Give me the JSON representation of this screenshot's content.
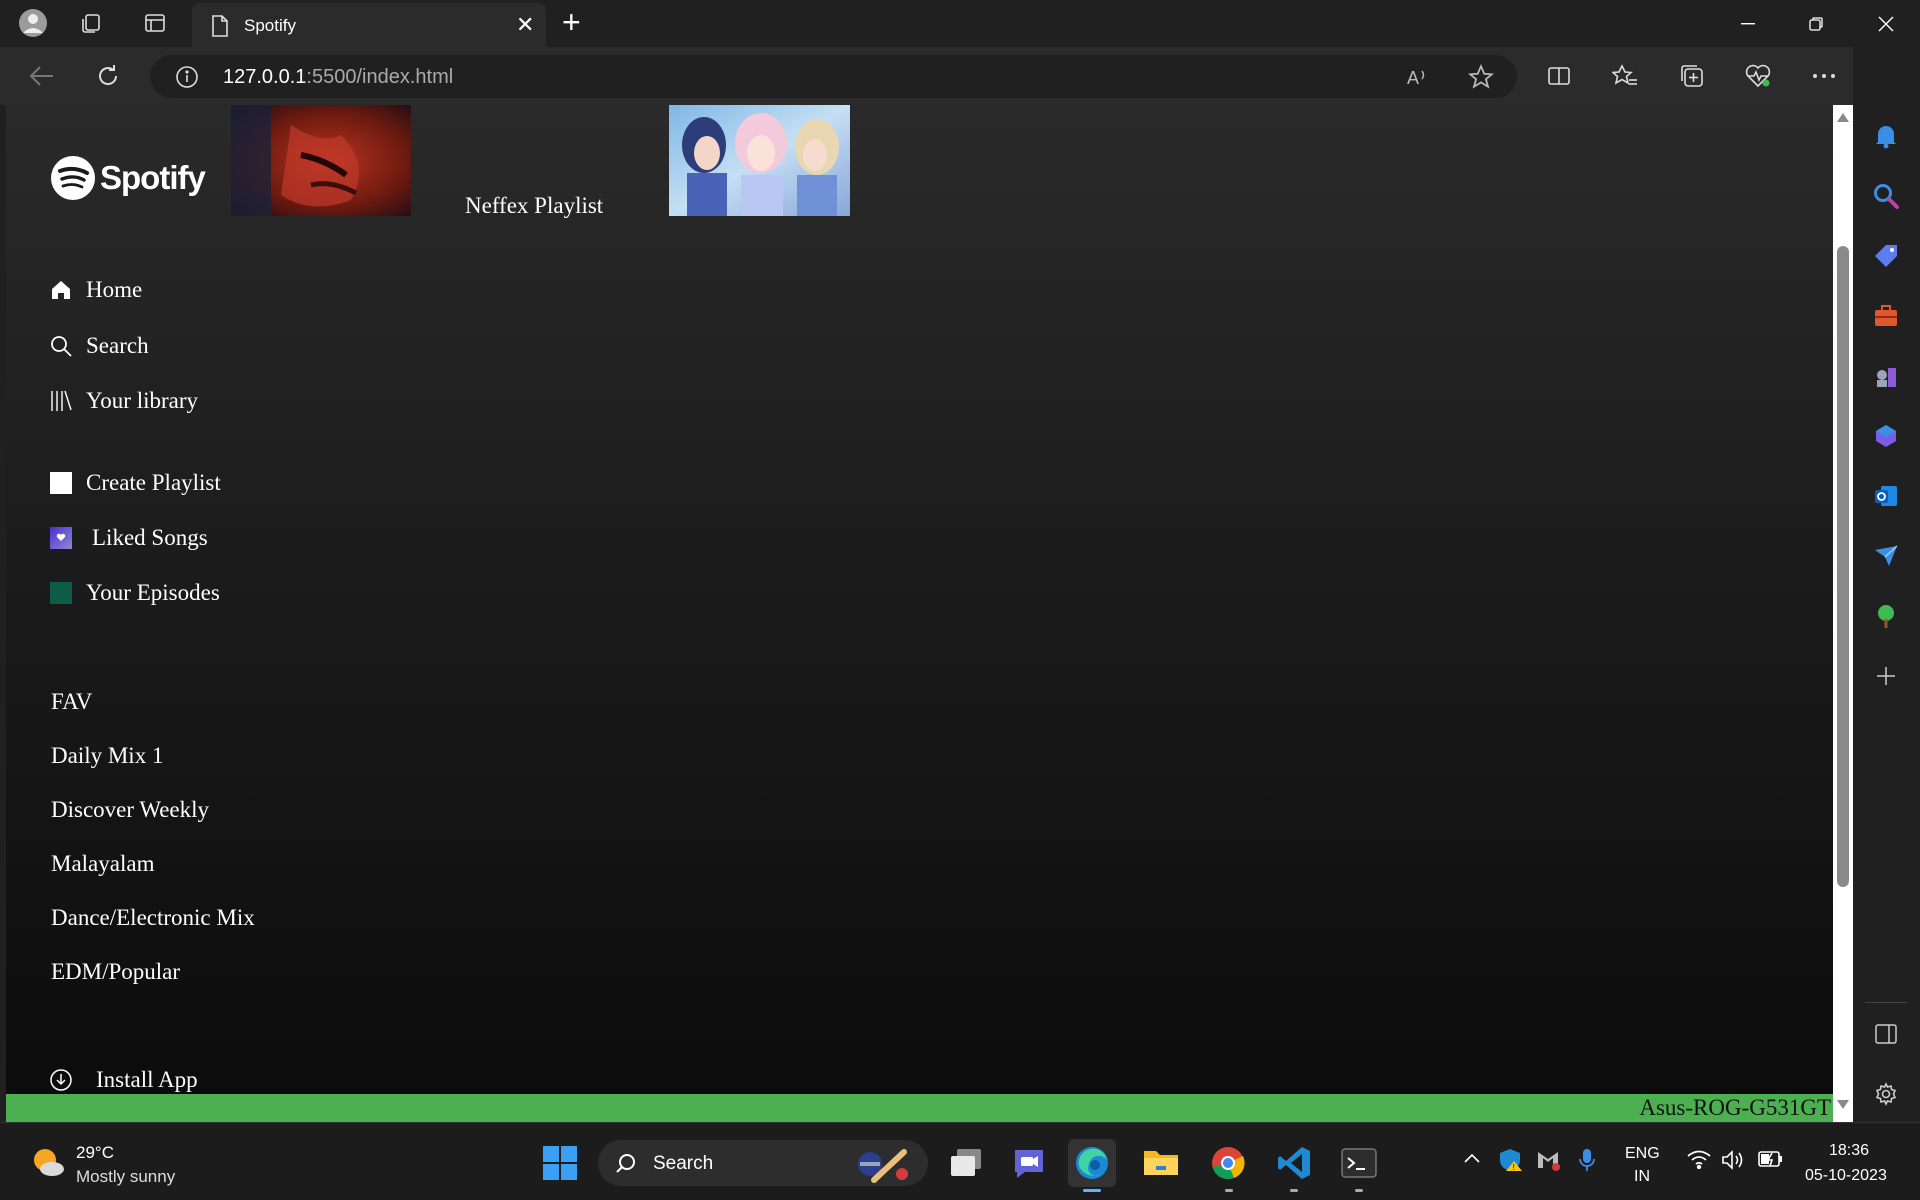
{
  "browser": {
    "tab_title": "Spotify",
    "tab_close": "✕",
    "new_tab": "+",
    "url_host": "127.0.0.1",
    "url_rest": ":5500/index.html",
    "window_controls": [
      "minimize-icon",
      "restore-icon",
      "close-icon"
    ]
  },
  "page": {
    "logo_text": "Spotify",
    "featured_title": "Neffex Playlist",
    "nav": [
      {
        "label": "Home",
        "icon": "home-icon"
      },
      {
        "label": "Search",
        "icon": "search-icon"
      },
      {
        "label": "Your library",
        "icon": "library-icon"
      }
    ],
    "actions": [
      {
        "label": "Create Playlist",
        "icon": "plus-square-icon"
      },
      {
        "label": "Liked Songs",
        "icon": "heart-icon"
      },
      {
        "label": "Your Episodes",
        "icon": "episodes-icon"
      }
    ],
    "playlists": [
      "FAV",
      "Daily Mix 1",
      "Discover Weekly",
      "Malayalam",
      "Dance/Electronic Mix",
      "EDM/Popular"
    ],
    "install_app": "Install App",
    "footer_text": "Asus-ROG-G531GT"
  },
  "taskbar": {
    "temperature": "29°C",
    "weather": "Mostly sunny",
    "search_label": "Search",
    "language_top": "ENG",
    "language_bottom": "IN",
    "time": "18:36",
    "date": "05-10-2023"
  },
  "colors": {
    "accent_green": "#4caf50",
    "spotify_white": "#ffffff",
    "episodes_green": "#0d5c45",
    "liked_purple": "#5038c8"
  }
}
